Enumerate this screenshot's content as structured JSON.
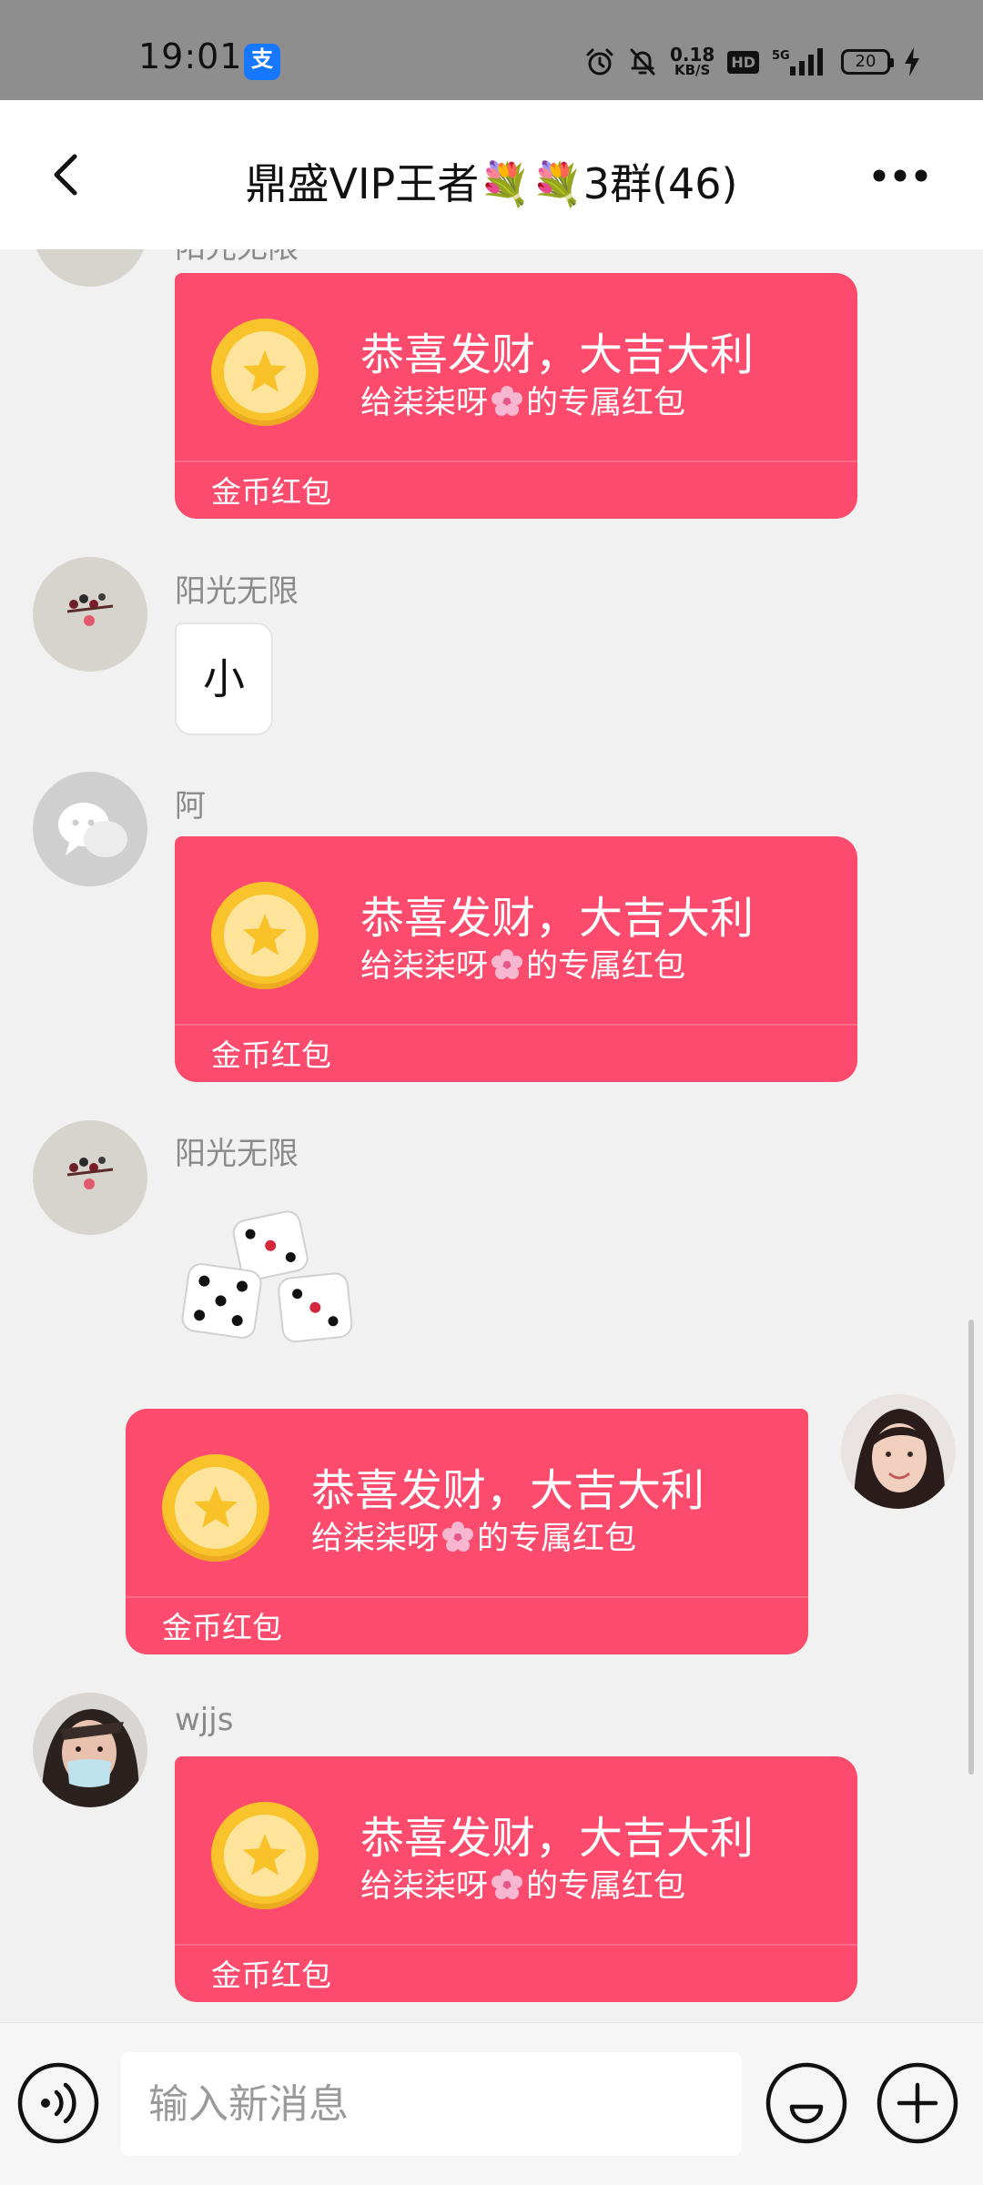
{
  "status_bar": {
    "time": "19:01",
    "alipay_glyph": "支",
    "net_speed_value": "0.18",
    "net_speed_unit": "KB/S",
    "hd_label": "HD",
    "network_type": "5G",
    "battery_level": "20",
    "icons": [
      "alipay-icon",
      "alarm-icon",
      "mute-bell-icon",
      "hd-icon",
      "signal-icon",
      "battery-icon",
      "charging-icon"
    ]
  },
  "header": {
    "title": "鼎盛VIP王者💐💐3群(46)",
    "back_icon": "back-arrow-icon",
    "more_icon": "more-dots-icon"
  },
  "messages": [
    {
      "type": "red_packet",
      "sender": "阳光无限",
      "partially_visible": true,
      "greeting": "恭喜发财，大吉大利",
      "desc_before": "给柒柒呀",
      "desc_emoji": "🌸",
      "desc_after": "的专属红包",
      "label": "金币红包"
    },
    {
      "type": "text",
      "sender": "阳光无限",
      "text": "小"
    },
    {
      "type": "red_packet",
      "sender": "阿",
      "greeting": "恭喜发财，大吉大利",
      "desc_before": "给柒柒呀",
      "desc_emoji": "🌸",
      "desc_after": "的专属红包",
      "label": "金币红包"
    },
    {
      "type": "sticker",
      "sender": "阳光无限",
      "sticker": "dice-icon"
    },
    {
      "type": "red_packet",
      "outgoing": true,
      "greeting": "恭喜发财，大吉大利",
      "desc_before": "给柒柒呀",
      "desc_emoji": "🌸",
      "desc_after": "的专属红包",
      "label": "金币红包"
    },
    {
      "type": "red_packet",
      "sender": "wjjs",
      "greeting": "恭喜发财，大吉大利",
      "desc_before": "给柒柒呀",
      "desc_emoji": "🌸",
      "desc_after": "的专属红包",
      "label": "金币红包"
    }
  ],
  "input_bar": {
    "placeholder": "输入新消息",
    "value": "",
    "voice_icon": "voice-icon",
    "emoji_icon": "emoji-icon",
    "plus_icon": "plus-icon"
  },
  "colors": {
    "red_packet": "#fc4b6c",
    "coin": "#f9c32c",
    "status_bar": "#8e8e8e",
    "chat_background": "#f1f1f1"
  }
}
